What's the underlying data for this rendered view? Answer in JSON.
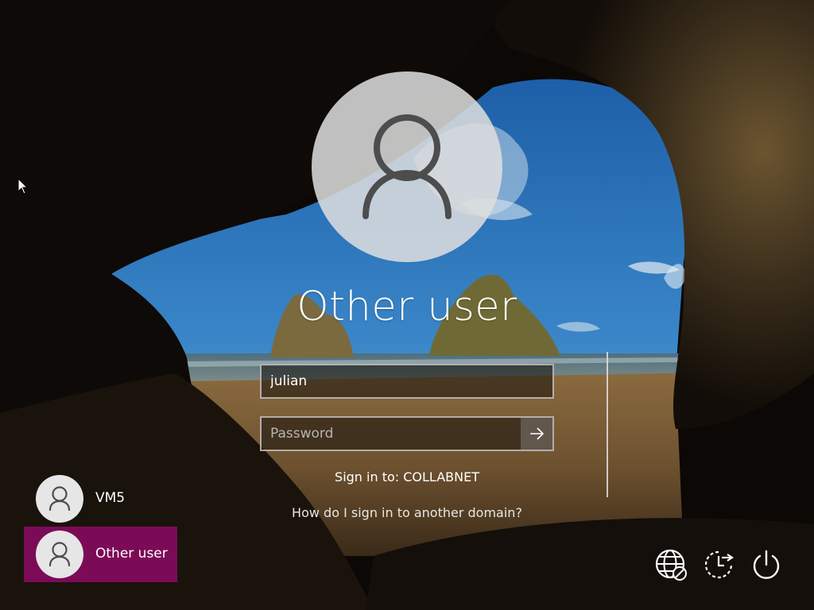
{
  "login": {
    "selected_user_name": "Other user",
    "username_value": "julian",
    "password_placeholder": "Password",
    "sign_in_to": "Sign in to: COLLABNET",
    "other_domain_link": "How do I sign in to another domain?"
  },
  "user_list": [
    {
      "name": "VM5",
      "selected": false,
      "icon": "user-icon"
    },
    {
      "name": "Other user",
      "selected": true,
      "icon": "user-icon"
    }
  ],
  "corner_buttons": [
    {
      "name": "network",
      "icon": "network-globe-icon"
    },
    {
      "name": "ease-of-access",
      "icon": "ease-of-access-icon"
    },
    {
      "name": "power",
      "icon": "power-icon"
    }
  ],
  "colors": {
    "selected_tile": "#7c0b57",
    "avatar_fill": "#dedede",
    "icon_stroke": "#4d4d4d"
  }
}
